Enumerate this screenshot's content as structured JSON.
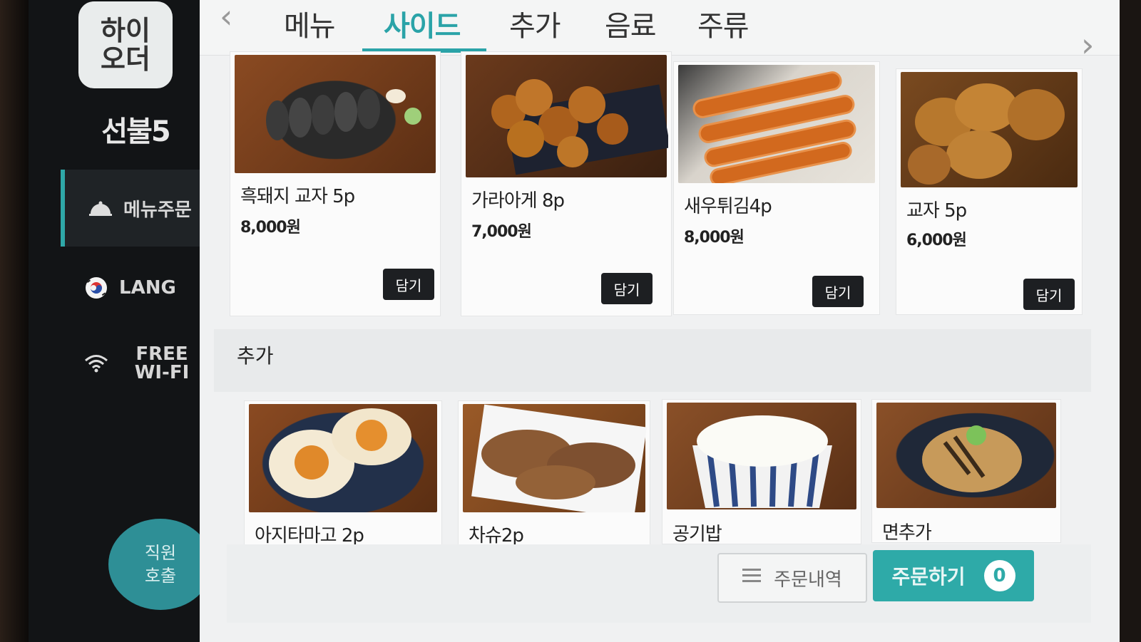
{
  "brand": {
    "logo_line1": "하이",
    "logo_line2": "오더"
  },
  "table_name": "선불5",
  "sidebar": {
    "items": [
      {
        "label": "메뉴주문",
        "icon": "cloche-icon",
        "active": true
      },
      {
        "label": "LANG",
        "icon": "korea-flag-icon",
        "active": false
      },
      {
        "label": "FREE WI-FI",
        "icon": "wifi-icon",
        "active": false
      }
    ],
    "staff_call_line1": "직원",
    "staff_call_line2": "호출"
  },
  "tabs": [
    {
      "label": "메뉴",
      "active": false
    },
    {
      "label": "사이드",
      "active": true
    },
    {
      "label": "추가",
      "active": false
    },
    {
      "label": "음료",
      "active": false
    },
    {
      "label": "주류",
      "active": false
    }
  ],
  "side_items": [
    {
      "name": "흑돼지 교자 5p",
      "price": "8,000원",
      "add_label": "담기",
      "photo": "black dumplings on plate"
    },
    {
      "name": "가라아게 8p",
      "price": "7,000원",
      "add_label": "담기",
      "photo": "fried chicken pieces"
    },
    {
      "name": "새우튀김4p",
      "price": "8,000원",
      "add_label": "담기",
      "photo": "fried shrimp"
    },
    {
      "name": "교자 5p",
      "price": "6,000원",
      "add_label": "담기",
      "photo": "pan-fried dumplings"
    }
  ],
  "extra_section": {
    "title": "추가",
    "items": [
      {
        "name": "아지타마고 2p"
      },
      {
        "name": "차슈2p"
      },
      {
        "name": "공기밥"
      },
      {
        "name": "면추가"
      }
    ]
  },
  "footer": {
    "history_label": "주문내역",
    "order_label": "주문하기",
    "order_count": "0"
  },
  "colors": {
    "accent": "#2aa3a8",
    "sidebar_bg": "#121416",
    "button_dark": "#1d1f22"
  }
}
